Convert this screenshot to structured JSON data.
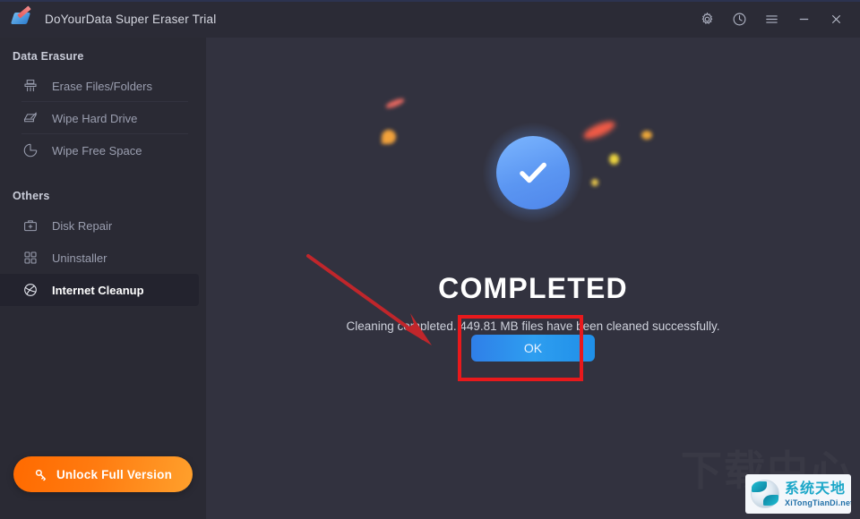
{
  "window": {
    "title": "DoYourData Super Eraser Trial",
    "logo_icon": "eraser-icon",
    "controls": [
      {
        "name": "settings-button",
        "icon": "gear-icon"
      },
      {
        "name": "history-button",
        "icon": "clock-icon"
      },
      {
        "name": "menu-button",
        "icon": "hamburger-icon"
      },
      {
        "name": "minimize-button",
        "icon": "minimize-icon"
      },
      {
        "name": "close-button",
        "icon": "close-icon"
      }
    ]
  },
  "sidebar": {
    "group1_title": "Data Erasure",
    "group2_title": "Others",
    "items": [
      {
        "label": "Erase Files/Folders",
        "icon": "shredder-icon",
        "active": false
      },
      {
        "label": "Wipe Hard Drive",
        "icon": "hard-drive-wipe-icon",
        "active": false
      },
      {
        "label": "Wipe Free Space",
        "icon": "pie-chart-icon",
        "active": false
      },
      {
        "label": "Disk Repair",
        "icon": "toolbox-icon",
        "active": false
      },
      {
        "label": "Uninstaller",
        "icon": "grid-squares-icon",
        "active": false
      },
      {
        "label": "Internet Cleanup",
        "icon": "globe-icon",
        "active": true
      }
    ],
    "unlock_label": "Unlock Full Version",
    "unlock_icon": "key-icon"
  },
  "main": {
    "status_icon": "check-circle-icon",
    "heading": "COMPLETED",
    "message": "Cleaning completed. 449.81 MB files have been cleaned successfully.",
    "ok_label": "OK"
  },
  "annotations": {
    "highlight_color": "#e8191c",
    "arrow_color": "#c0262b"
  },
  "watermark": {
    "background_text": "下载中心",
    "logo_cn": "系统天地",
    "logo_en": "XiTongTianDi.net"
  },
  "colors": {
    "titlebar": "#2b2b36",
    "sidebar": "#2a2a34",
    "main": "#32323f",
    "accent_blue": "#2e9ef0",
    "accent_orange": "#ff7b10",
    "active_item": "#23232e"
  }
}
